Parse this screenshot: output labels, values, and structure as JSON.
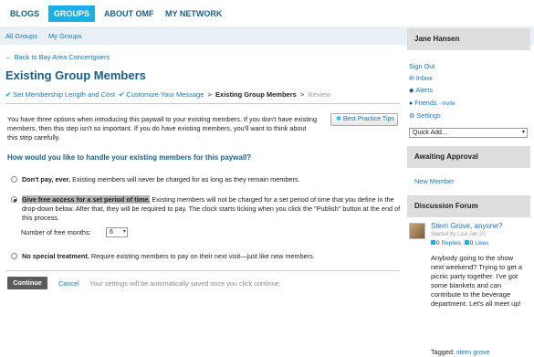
{
  "topnav": {
    "tabs": [
      {
        "label": "BLOGS"
      },
      {
        "label": "GROUPS"
      },
      {
        "label": "ABOUT OMF"
      },
      {
        "label": "MY NETWORK"
      }
    ]
  },
  "subnav": {
    "all_groups": "All Groups",
    "my_groups": "My Groups"
  },
  "main": {
    "back_link": "← Back to Bay Area Concertgoers",
    "title": "Existing Group Members",
    "steps": {
      "step1": "Set Membership Length and Cost",
      "step2": "Customize Your Message",
      "separator": ">",
      "current": "Existing Group Members",
      "next": "Review"
    },
    "intro": "You have three options when introducing this paywall to your existing members. If you don't have existing members, then this step isn't so important. If you do have existing members, you'll want to think about this step carefully.",
    "best_practice_button": "Best Practice Tips",
    "question": "How would you like to handle your existing members for this paywall?",
    "options": [
      {
        "bold": "Don't pay, ever.",
        "text": " Existing members will never be charged for as long as they remain members.",
        "selected": false
      },
      {
        "bold": "Give free access for a set period of time.",
        "text": " Existing members will not be charged for a set period of time that you define in the drop-down below. After that, they will be required to pay. The clock starts ticking when you click the \"Publish\" button at the end of this process.",
        "selected": true
      },
      {
        "bold": "No special treatment.",
        "text": " Require existing members to pay on their next visit—just like new members.",
        "selected": false
      }
    ],
    "free_months_label": "Number of free months:",
    "free_months_value": "6",
    "continue_button": "Continue",
    "cancel_link": "Cancel",
    "autosave_note": "Your settings will be automatically saved once you click continue."
  },
  "sidebar": {
    "user_name": "Jane Hansen",
    "sign_out": "Sign Out",
    "inbox": "Inbox",
    "alerts": "Alerts",
    "friends": "Friends",
    "invite": "- Invite",
    "settings": "Settings",
    "quick_add": "Quick Add...",
    "awaiting_title": "Awaiting Approval",
    "new_member": "New Member",
    "forum_title": "Discussion Forum",
    "post": {
      "title": "Stern Grove, anyone?",
      "meta": "Started by Lisa Jun 20.",
      "replies_count": "0",
      "replies_label": "Replies",
      "likes_count": "0",
      "likes_label": "Likes",
      "body": "Anybody going to the show next weekend? Trying to get a picnic party together. I've got some blankets and can contribute to the beverage department. Let's all meet up!",
      "tagged_label": "Tagged:",
      "tag": "stern grove"
    }
  },
  "colors": {
    "accent": "#1eaee6",
    "link": "#1776b8",
    "heading": "#1b5e8c"
  }
}
